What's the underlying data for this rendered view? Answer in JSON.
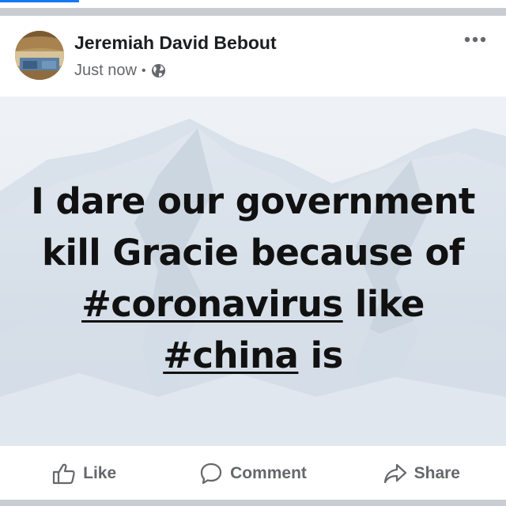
{
  "post": {
    "author_name": "Jeremiah David Bebout",
    "timestamp": "Just now",
    "separator": "•",
    "privacy_icon": "globe-icon",
    "more_icon": "more-options-icon",
    "text_line1": "I dare our government",
    "text_line2": "kill Gracie because of",
    "hashtag1": "#coronavirus",
    "text_after_hashtag1": " like",
    "hashtag2": "#china",
    "text_after_hashtag2": " is",
    "background": "snowy-mountains"
  },
  "actions": {
    "like_label": "Like",
    "comment_label": "Comment",
    "share_label": "Share"
  },
  "colors": {
    "brand": "#1877f2",
    "action_text": "#65676b",
    "author_text": "#1c1e21",
    "separator_bg": "#c9ccd1"
  }
}
